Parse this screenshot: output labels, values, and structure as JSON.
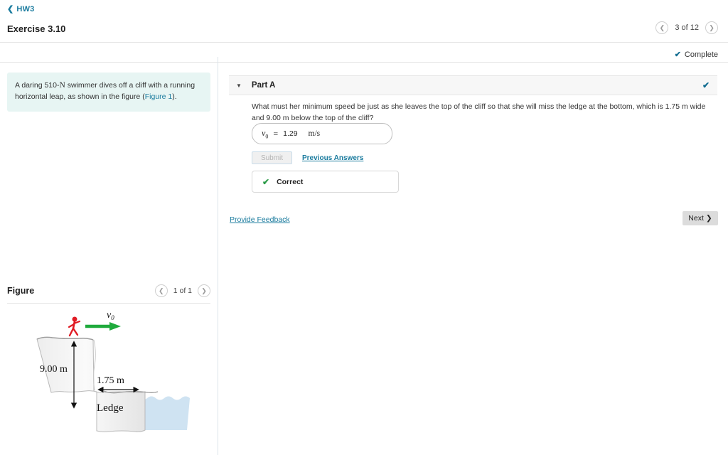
{
  "breadcrumb": {
    "back_icon": "chevron-left-icon",
    "label": "HW3"
  },
  "header": {
    "exercise_title": "Exercise 3.10",
    "pager": {
      "prev_icon": "chevron-left-icon",
      "position": "3 of 12",
      "next_icon": "chevron-right-icon"
    },
    "status": {
      "icon": "check-icon",
      "label": "Complete"
    }
  },
  "problem": {
    "text_a": "A daring 510-",
    "text_n": "N",
    "text_b": " swimmer dives off a cliff with a running horizontal leap, as shown in the figure (",
    "link": "Figure 1",
    "text_c": ")."
  },
  "figure_panel": {
    "title": "Figure",
    "pager": {
      "prev_icon": "chevron-left-icon",
      "position": "1 of 1",
      "next_icon": "chevron-right-icon"
    },
    "diagram": {
      "velocity_label": "v",
      "velocity_sub": "0",
      "height_label": "9.00 m",
      "width_label": "1.75 m",
      "ledge_label": "Ledge",
      "arrow_color": "#1faa3c",
      "runner_color": "#e01b24",
      "water_color": "#cfe3f2",
      "cliff_color": "#f1f1f1"
    }
  },
  "part_a": {
    "caret_icon": "chevron-down-icon",
    "label": "Part A",
    "status_icon": "check-icon",
    "question": "What must her minimum speed be just as she leaves the top of the cliff so that she will miss the ledge at the bottom, which is 1.75 m wide and 9.00 m below the top of the cliff?",
    "answer": {
      "symbol": "v",
      "symbol_sub": "0",
      "equals": "=",
      "value": "1.29",
      "unit": "m/s"
    },
    "submit_label": "Submit",
    "previous_answers_label": "Previous Answers",
    "result": {
      "icon": "check-icon",
      "label": "Correct"
    }
  },
  "footer": {
    "feedback_label": "Provide Feedback",
    "next_label": "Next",
    "next_icon": "chevron-right-icon"
  },
  "colors": {
    "link": "#1a7b9e",
    "problem_bg": "#e7f5f3",
    "correct_green": "#2e9c4a",
    "tick_blue": "#136d91"
  }
}
